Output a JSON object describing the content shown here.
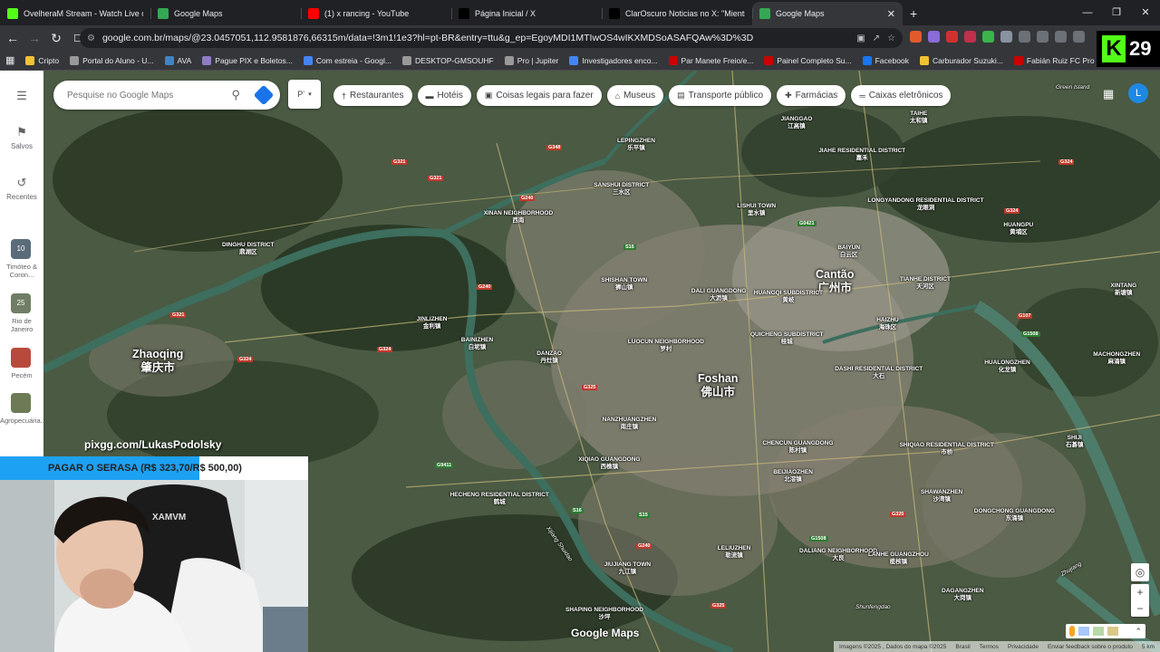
{
  "browser": {
    "tabs": [
      {
        "title": "OvelheraM Stream - Watch Live on K",
        "icon_color": "#53fc18",
        "active": false
      },
      {
        "title": "Google Maps",
        "icon_color": "#34a853",
        "active": false
      },
      {
        "title": "(1) x rancing - YouTube",
        "icon_color": "#ff0000",
        "active": false
      },
      {
        "title": "Página Inicial / X",
        "icon_color": "#000000",
        "active": false
      },
      {
        "title": "ClarOscuro Noticias no X: \"Mientras",
        "icon_color": "#000000",
        "active": false
      },
      {
        "title": "Google Maps",
        "icon_color": "#34a853",
        "active": true
      }
    ],
    "new_tab": "+",
    "url": "google.com.br/maps/@23.0457051,112.9581876,66315m/data=!3m1!1e3?hl=pt-BR&entry=ttu&g_ep=EgoyMDI1MTIwOS4wIKXMDSoASAFQAw%3D%3D",
    "bookmarks": [
      {
        "label": "Cripto",
        "color": "#f1c232"
      },
      {
        "label": "Portal do Aluno - U...",
        "color": "#999999"
      },
      {
        "label": "AVA",
        "color": "#3d85c6"
      },
      {
        "label": "Pague PIX e Boletos...",
        "color": "#8e7cc3"
      },
      {
        "label": "Com estreia - Googl...",
        "color": "#4285f4"
      },
      {
        "label": "DESKTOP-GMSOUHF",
        "color": "#999999"
      },
      {
        "label": "Pro | Jupiter",
        "color": "#999999"
      },
      {
        "label": "Investigadores enco...",
        "color": "#4285f4"
      },
      {
        "label": "Par Manete Freio/e...",
        "color": "#cc0000"
      },
      {
        "label": "Painel Completo Su...",
        "color": "#cc0000"
      },
      {
        "label": "Facebook",
        "color": "#1877f2"
      },
      {
        "label": "Carburador Suzuki...",
        "color": "#f1c232"
      },
      {
        "label": "Fabián Ruiz FC Pro L...",
        "color": "#cc0000"
      }
    ]
  },
  "kick_badge": {
    "logo": "K",
    "count": "29"
  },
  "maps": {
    "search_placeholder": "Pesquise no Google Maps",
    "layer_label": "P‵",
    "chips": [
      {
        "label": "Restaurantes",
        "icon": "fork-knife-icon"
      },
      {
        "label": "Hotéis",
        "icon": "bed-icon"
      },
      {
        "label": "Coisas legais para fazer",
        "icon": "camera-icon"
      },
      {
        "label": "Museus",
        "icon": "museum-icon"
      },
      {
        "label": "Transporte público",
        "icon": "train-icon"
      },
      {
        "label": "Farmácias",
        "icon": "pharmacy-icon"
      },
      {
        "label": "Caixas eletrônicos",
        "icon": "atm-icon"
      }
    ],
    "rail": {
      "saved": "Salvos",
      "recent": "Recentes",
      "recents": [
        {
          "label": "Timóteo & Coron...",
          "badge": "10"
        },
        {
          "label": "Rio de Janeiro",
          "badge": "25"
        },
        {
          "label": "Pecém",
          "badge": ""
        },
        {
          "label": "Agropecuária...",
          "badge": ""
        }
      ]
    },
    "avatar_letter": "L",
    "watermark": "Google Maps",
    "footer": [
      "Imagens ©2025 , Dados do mapa ©2025",
      "Brasil",
      "Termos",
      "Privacidade",
      "Enviar feedback sobre o produto",
      "5 km"
    ],
    "cities": [
      {
        "name": "Cantão",
        "native": "广州市"
      },
      {
        "name": "Foshan",
        "native": "佛山市"
      },
      {
        "name": "Zhaoqing",
        "native": "肇庆市"
      }
    ],
    "places": [
      {
        "name": "JIANGGAO",
        "native": "江高镇"
      },
      {
        "name": "TAIHE",
        "native": "太和镇"
      },
      {
        "name": "LEPINGZHEN",
        "native": "乐平镇"
      },
      {
        "name": "SANSHUI DISTRICT",
        "native": "三水区"
      },
      {
        "name": "JIAHE RESIDENTIAL DISTRICT",
        "native": "嘉禾"
      },
      {
        "name": "LONGYANDONG RESIDENTIAL DISTRICT",
        "native": "龙眼洞"
      },
      {
        "name": "XINAN NEIGHBORHOOD",
        "native": "西南"
      },
      {
        "name": "LISHUI TOWN",
        "native": "里水镇"
      },
      {
        "name": "BAIYUN",
        "native": "白云区"
      },
      {
        "name": "HUANGPU",
        "native": "黄埔区"
      },
      {
        "name": "DINGHU DISTRICT",
        "native": "鼎湖区"
      },
      {
        "name": "SHISHAN TOWN",
        "native": "狮山镇"
      },
      {
        "name": "DALI GUANGDONG",
        "native": "大沥镇"
      },
      {
        "name": "HUANGQI SUBDISTRICT",
        "native": "黄岐"
      },
      {
        "name": "TIANHE DISTRICT",
        "native": "天河区"
      },
      {
        "name": "XINTANG",
        "native": "新塘镇"
      },
      {
        "name": "JINLIZHEN",
        "native": "金利镇"
      },
      {
        "name": "BAINIZHEN",
        "native": "白坭镇"
      },
      {
        "name": "DANZAO",
        "native": "丹灶镇"
      },
      {
        "name": "LUOCUN NEIGHBORHOOD",
        "native": "罗村"
      },
      {
        "name": "HAIZHU",
        "native": "海珠区"
      },
      {
        "name": "HUALONGZHEN",
        "native": "化龙镇"
      },
      {
        "name": "MACHONGZHEN",
        "native": "麻涌镇"
      },
      {
        "name": "QUICHENG SUBDISTRICT",
        "native": "桂城"
      },
      {
        "name": "DASHI RESIDENTIAL DISTRICT",
        "native": "大石"
      },
      {
        "name": "NANZHUANGZHEN",
        "native": "南庄镇"
      },
      {
        "name": "XIQIAO GUANGDONG",
        "native": "西樵镇"
      },
      {
        "name": "CHENCUN GUANGDONG",
        "native": "陈村镇"
      },
      {
        "name": "SHIQIAO RESIDENTIAL DISTRICT",
        "native": "市桥"
      },
      {
        "name": "SHIJI",
        "native": "石碁镇"
      },
      {
        "name": "BEIJIAOZHEN",
        "native": "北滘镇"
      },
      {
        "name": "SHAWANZHEN",
        "native": "沙湾镇"
      },
      {
        "name": "HECHENG RESIDENTIAL DISTRICT",
        "native": "鹤城"
      },
      {
        "name": "DONGCHONG GUANGDONG",
        "native": "东涌镇"
      },
      {
        "name": "LELIUZHEN",
        "native": "勒流镇"
      },
      {
        "name": "DALIANG NEIGHBORHOOD",
        "native": "大良"
      },
      {
        "name": "LANHE GUANGZHOU",
        "native": "榄核镇"
      },
      {
        "name": "DAGANGZHEN",
        "native": "大岗镇"
      },
      {
        "name": "JIUJIANG TOWN",
        "native": "九江镇"
      },
      {
        "name": "SHAPING NEIGHBORHOOD",
        "native": "沙坪"
      }
    ],
    "small_places": [
      "Green Island",
      "Xijiang Shuidao",
      "Shunfengdao",
      "Zhujiang"
    ]
  },
  "stream": {
    "overlay_url": "pixgg.com/LukasPodolsky",
    "goal_text": "PAGAR O SERASA (R$ 323,70/R$ 500,00)",
    "goal_progress": 0.6474,
    "webcam_chair_text": "XAMVM"
  }
}
